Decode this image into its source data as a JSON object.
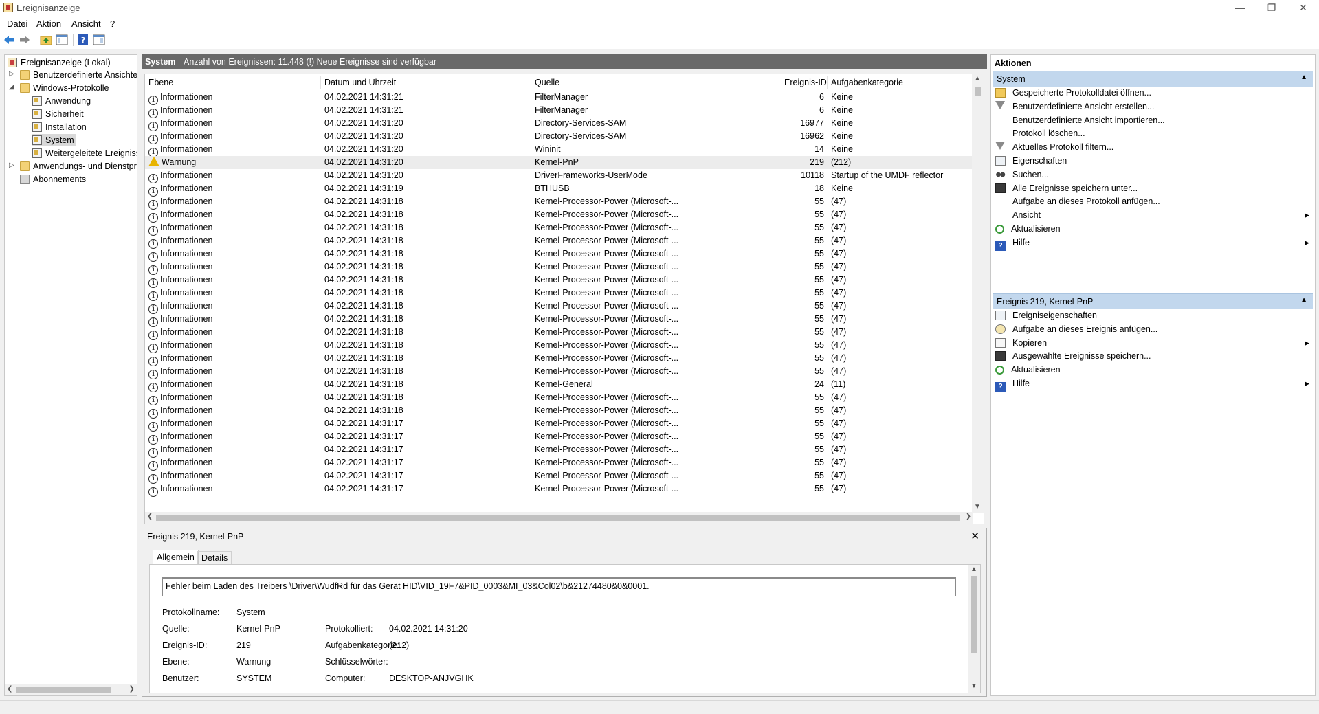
{
  "window": {
    "title": "Ereignisanzeige",
    "minimize_glyph": "—",
    "restore_glyph": "❐",
    "close_glyph": "✕"
  },
  "menu": [
    "Datei",
    "Aktion",
    "Ansicht",
    "?"
  ],
  "tree": {
    "root": "Ereignisanzeige (Lokal)",
    "custom_views": "Benutzerdefinierte Ansichten",
    "windows_logs": "Windows-Protokolle",
    "logs": [
      "Anwendung",
      "Sicherheit",
      "Installation",
      "System",
      "Weitergeleitete Ereignisse"
    ],
    "app_services": "Anwendungs- und Dienstprotokolle",
    "subscriptions": "Abonnements",
    "selected": "System"
  },
  "center": {
    "log_name": "System",
    "event_count": "Anzahl von Ereignissen: 11.448 (!) Neue Ereignisse sind verfügbar",
    "columns": [
      "Ebene",
      "Datum und Uhrzeit",
      "Quelle",
      "Ereignis-ID",
      "Aufgabenkategorie"
    ],
    "rows": [
      {
        "level": "Informationen",
        "dt": "04.02.2021 14:31:21",
        "src": "FilterManager",
        "id": "6",
        "cat": "Keine"
      },
      {
        "level": "Informationen",
        "dt": "04.02.2021 14:31:21",
        "src": "FilterManager",
        "id": "6",
        "cat": "Keine"
      },
      {
        "level": "Informationen",
        "dt": "04.02.2021 14:31:20",
        "src": "Directory-Services-SAM",
        "id": "16977",
        "cat": "Keine"
      },
      {
        "level": "Informationen",
        "dt": "04.02.2021 14:31:20",
        "src": "Directory-Services-SAM",
        "id": "16962",
        "cat": "Keine"
      },
      {
        "level": "Informationen",
        "dt": "04.02.2021 14:31:20",
        "src": "Wininit",
        "id": "14",
        "cat": "Keine"
      },
      {
        "level": "Warnung",
        "dt": "04.02.2021 14:31:20",
        "src": "Kernel-PnP",
        "id": "219",
        "cat": "(212)"
      },
      {
        "level": "Informationen",
        "dt": "04.02.2021 14:31:20",
        "src": "DriverFrameworks-UserMode",
        "id": "10118",
        "cat": "Startup of the UMDF reflector"
      },
      {
        "level": "Informationen",
        "dt": "04.02.2021 14:31:19",
        "src": "BTHUSB",
        "id": "18",
        "cat": "Keine"
      },
      {
        "level": "Informationen",
        "dt": "04.02.2021 14:31:18",
        "src": "Kernel-Processor-Power (Microsoft-...",
        "id": "55",
        "cat": "(47)"
      },
      {
        "level": "Informationen",
        "dt": "04.02.2021 14:31:18",
        "src": "Kernel-Processor-Power (Microsoft-...",
        "id": "55",
        "cat": "(47)"
      },
      {
        "level": "Informationen",
        "dt": "04.02.2021 14:31:18",
        "src": "Kernel-Processor-Power (Microsoft-...",
        "id": "55",
        "cat": "(47)"
      },
      {
        "level": "Informationen",
        "dt": "04.02.2021 14:31:18",
        "src": "Kernel-Processor-Power (Microsoft-...",
        "id": "55",
        "cat": "(47)"
      },
      {
        "level": "Informationen",
        "dt": "04.02.2021 14:31:18",
        "src": "Kernel-Processor-Power (Microsoft-...",
        "id": "55",
        "cat": "(47)"
      },
      {
        "level": "Informationen",
        "dt": "04.02.2021 14:31:18",
        "src": "Kernel-Processor-Power (Microsoft-...",
        "id": "55",
        "cat": "(47)"
      },
      {
        "level": "Informationen",
        "dt": "04.02.2021 14:31:18",
        "src": "Kernel-Processor-Power (Microsoft-...",
        "id": "55",
        "cat": "(47)"
      },
      {
        "level": "Informationen",
        "dt": "04.02.2021 14:31:18",
        "src": "Kernel-Processor-Power (Microsoft-...",
        "id": "55",
        "cat": "(47)"
      },
      {
        "level": "Informationen",
        "dt": "04.02.2021 14:31:18",
        "src": "Kernel-Processor-Power (Microsoft-...",
        "id": "55",
        "cat": "(47)"
      },
      {
        "level": "Informationen",
        "dt": "04.02.2021 14:31:18",
        "src": "Kernel-Processor-Power (Microsoft-...",
        "id": "55",
        "cat": "(47)"
      },
      {
        "level": "Informationen",
        "dt": "04.02.2021 14:31:18",
        "src": "Kernel-Processor-Power (Microsoft-...",
        "id": "55",
        "cat": "(47)"
      },
      {
        "level": "Informationen",
        "dt": "04.02.2021 14:31:18",
        "src": "Kernel-Processor-Power (Microsoft-...",
        "id": "55",
        "cat": "(47)"
      },
      {
        "level": "Informationen",
        "dt": "04.02.2021 14:31:18",
        "src": "Kernel-Processor-Power (Microsoft-...",
        "id": "55",
        "cat": "(47)"
      },
      {
        "level": "Informationen",
        "dt": "04.02.2021 14:31:18",
        "src": "Kernel-Processor-Power (Microsoft-...",
        "id": "55",
        "cat": "(47)"
      },
      {
        "level": "Informationen",
        "dt": "04.02.2021 14:31:18",
        "src": "Kernel-General",
        "id": "24",
        "cat": "(11)"
      },
      {
        "level": "Informationen",
        "dt": "04.02.2021 14:31:18",
        "src": "Kernel-Processor-Power (Microsoft-...",
        "id": "55",
        "cat": "(47)"
      },
      {
        "level": "Informationen",
        "dt": "04.02.2021 14:31:18",
        "src": "Kernel-Processor-Power (Microsoft-...",
        "id": "55",
        "cat": "(47)"
      },
      {
        "level": "Informationen",
        "dt": "04.02.2021 14:31:17",
        "src": "Kernel-Processor-Power (Microsoft-...",
        "id": "55",
        "cat": "(47)"
      },
      {
        "level": "Informationen",
        "dt": "04.02.2021 14:31:17",
        "src": "Kernel-Processor-Power (Microsoft-...",
        "id": "55",
        "cat": "(47)"
      },
      {
        "level": "Informationen",
        "dt": "04.02.2021 14:31:17",
        "src": "Kernel-Processor-Power (Microsoft-...",
        "id": "55",
        "cat": "(47)"
      },
      {
        "level": "Informationen",
        "dt": "04.02.2021 14:31:17",
        "src": "Kernel-Processor-Power (Microsoft-...",
        "id": "55",
        "cat": "(47)"
      },
      {
        "level": "Informationen",
        "dt": "04.02.2021 14:31:17",
        "src": "Kernel-Processor-Power (Microsoft-...",
        "id": "55",
        "cat": "(47)"
      },
      {
        "level": "Informationen",
        "dt": "04.02.2021 14:31:17",
        "src": "Kernel-Processor-Power (Microsoft-...",
        "id": "55",
        "cat": "(47)"
      }
    ]
  },
  "detail": {
    "title": "Ereignis 219, Kernel-PnP",
    "tabs": [
      "Allgemein",
      "Details"
    ],
    "description": "Fehler beim Laden des Treibers \\Driver\\WudfRd für das Gerät HID\\VID_19F7&PID_0003&MI_03&Col02\\b&21274480&0&0001.",
    "labels": {
      "log_name": "Protokollname:",
      "source": "Quelle:",
      "event_id": "Ereignis-ID:",
      "level": "Ebene:",
      "user": "Benutzer:",
      "logged": "Protokolliert:",
      "task_category": "Aufgabenkategorie:",
      "keywords": "Schlüsselwörter:",
      "computer": "Computer:"
    },
    "values": {
      "log_name": "System",
      "source": "Kernel-PnP",
      "event_id": "219",
      "level": "Warnung",
      "user": "SYSTEM",
      "logged": "04.02.2021 14:31:20",
      "task_category": "(212)",
      "keywords": "",
      "computer": "DESKTOP-ANJVGHK"
    }
  },
  "actions": {
    "header": "Aktionen",
    "section1": "System",
    "section1_items": [
      {
        "label": "Gespeicherte Protokolldatei öffnen...",
        "icon": "open-log-icon",
        "submenu": false
      },
      {
        "label": "Benutzerdefinierte Ansicht erstellen...",
        "icon": "filter-icon",
        "submenu": false
      },
      {
        "label": "Benutzerdefinierte Ansicht importieren...",
        "icon": "",
        "submenu": false
      },
      {
        "label": "Protokoll löschen...",
        "icon": "",
        "submenu": false
      },
      {
        "label": "Aktuelles Protokoll filtern...",
        "icon": "filter-icon",
        "submenu": false
      },
      {
        "label": "Eigenschaften",
        "icon": "properties-icon",
        "submenu": false
      },
      {
        "label": "Suchen...",
        "icon": "find-icon",
        "submenu": false
      },
      {
        "label": "Alle Ereignisse speichern unter...",
        "icon": "save-icon",
        "submenu": false
      },
      {
        "label": "Aufgabe an dieses Protokoll anfügen...",
        "icon": "",
        "submenu": false
      },
      {
        "label": "Ansicht",
        "icon": "",
        "submenu": true
      },
      {
        "label": "Aktualisieren",
        "icon": "refresh-icon",
        "submenu": false
      },
      {
        "label": "Hilfe",
        "icon": "help-icon",
        "submenu": true
      }
    ],
    "section2": "Ereignis 219, Kernel-PnP",
    "section2_items": [
      {
        "label": "Ereigniseigenschaften",
        "icon": "event-properties-icon",
        "submenu": false
      },
      {
        "label": "Aufgabe an dieses Ereignis anfügen...",
        "icon": "task-icon",
        "submenu": false
      },
      {
        "label": "Kopieren",
        "icon": "copy-icon",
        "submenu": true
      },
      {
        "label": "Ausgewählte Ereignisse speichern...",
        "icon": "save-icon",
        "submenu": false
      },
      {
        "label": "Aktualisieren",
        "icon": "refresh-icon",
        "submenu": false
      },
      {
        "label": "Hilfe",
        "icon": "help-icon",
        "submenu": true
      }
    ]
  },
  "colors": {
    "section_bg": "#c2d7ed",
    "header_bar": "#696969",
    "warning": "#e8b400"
  }
}
